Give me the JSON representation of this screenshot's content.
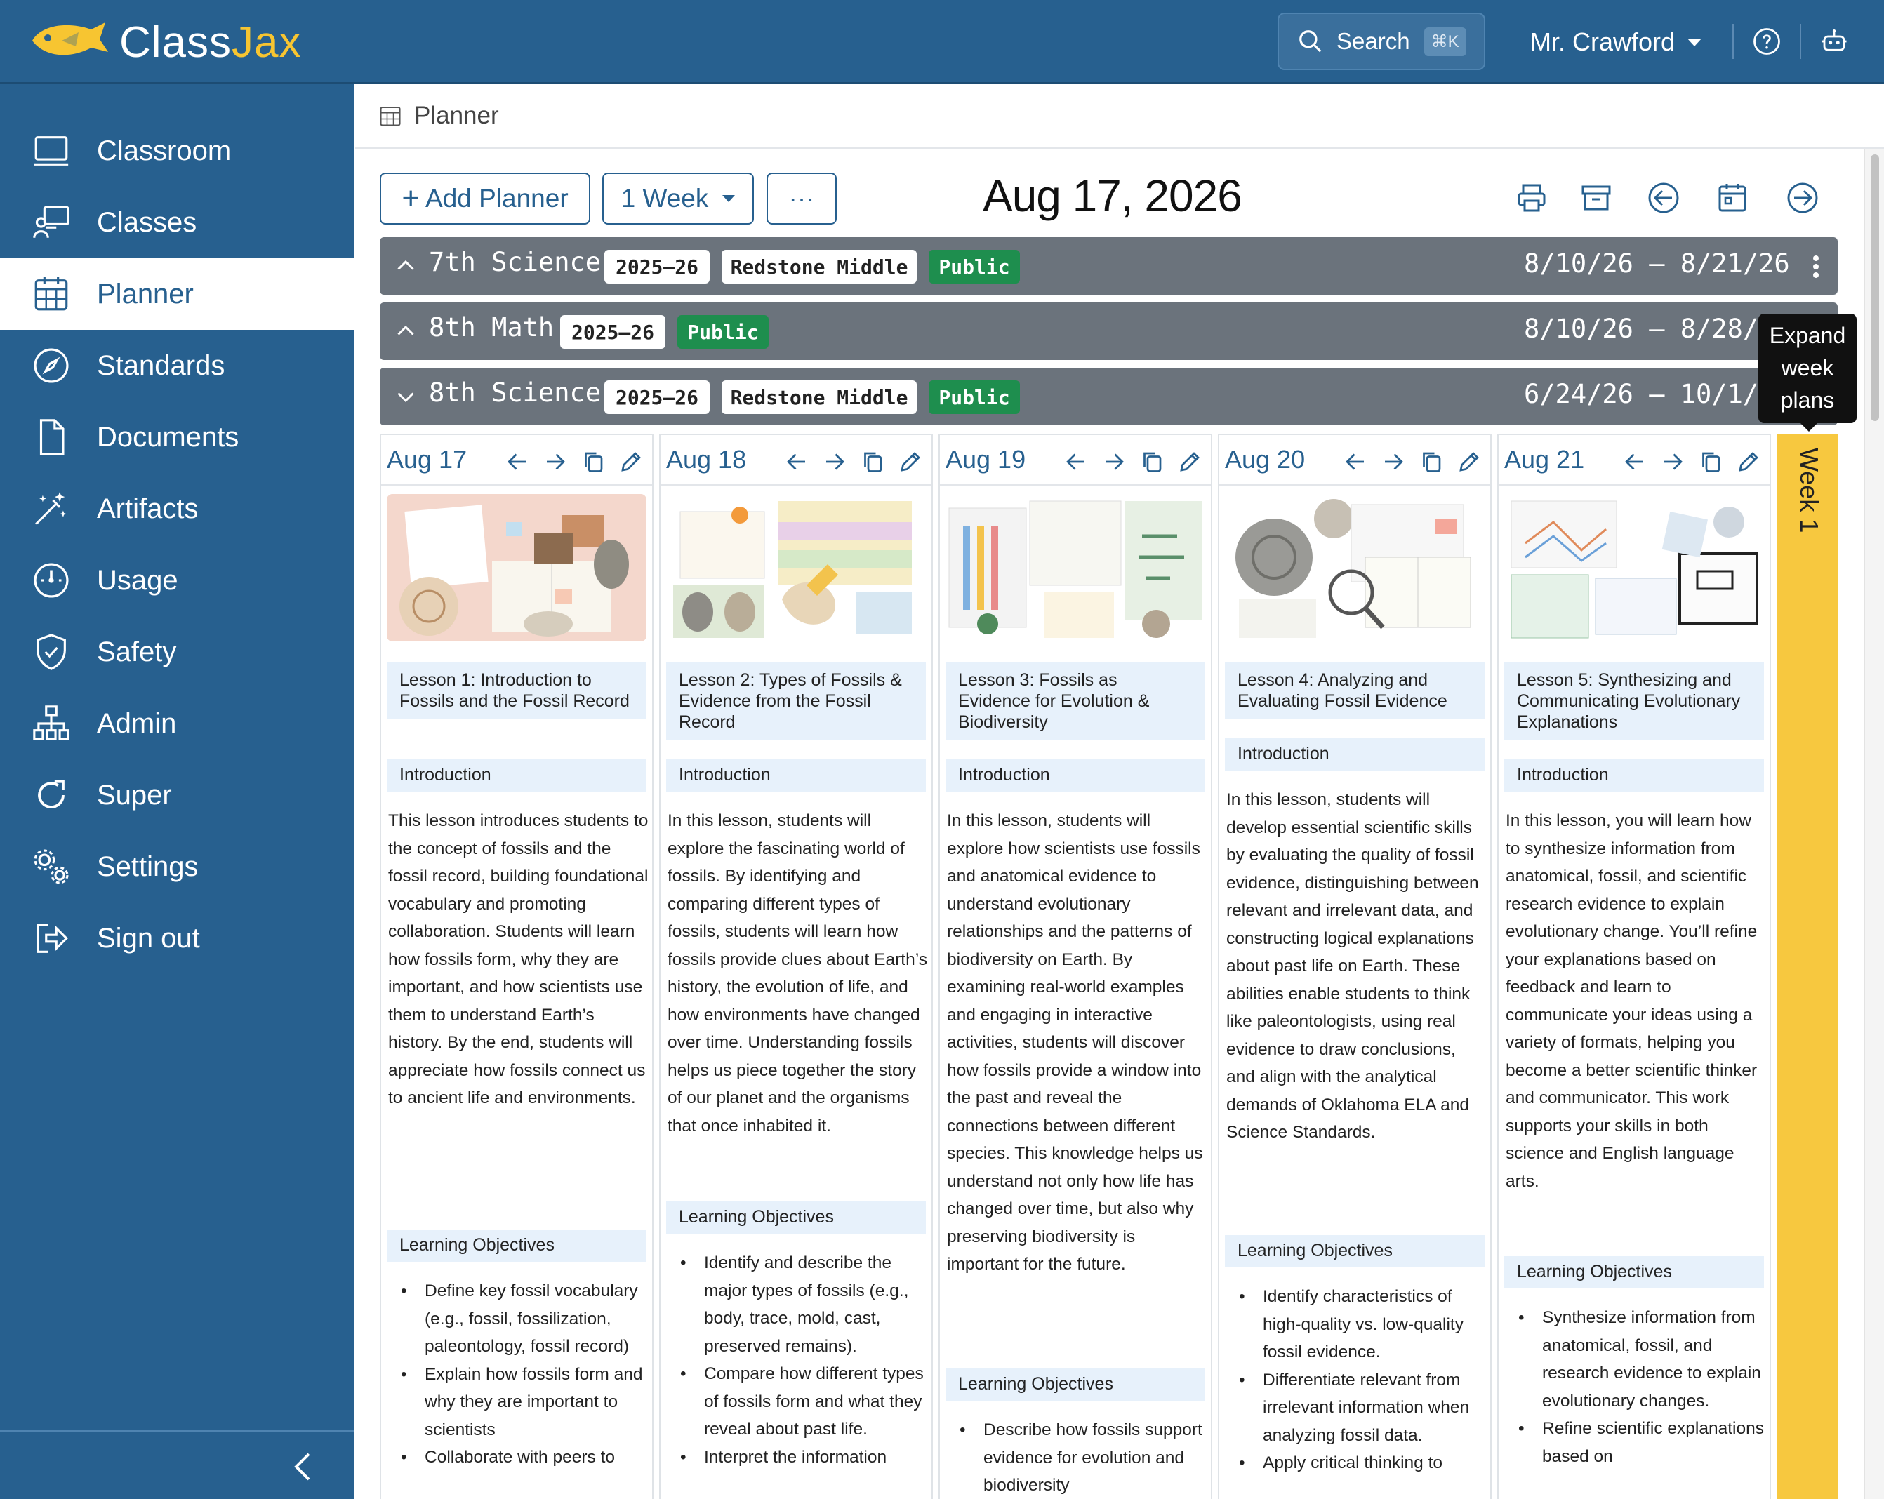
{
  "app": {
    "brand_part1": "Class",
    "brand_part2": "Jax",
    "search_label": "Search",
    "search_shortcut": "⌘K",
    "user_name": "Mr. Crawford"
  },
  "sidebar": {
    "items": [
      {
        "label": "Classroom",
        "icon": "monitor-icon"
      },
      {
        "label": "Classes",
        "icon": "teacher-board-icon"
      },
      {
        "label": "Planner",
        "icon": "calendar-grid-icon",
        "active": true
      },
      {
        "label": "Standards",
        "icon": "compass-icon"
      },
      {
        "label": "Documents",
        "icon": "document-icon"
      },
      {
        "label": "Artifacts",
        "icon": "magic-wand-icon"
      },
      {
        "label": "Usage",
        "icon": "gauge-icon"
      },
      {
        "label": "Safety",
        "icon": "shield-check-icon"
      },
      {
        "label": "Admin",
        "icon": "org-chart-icon"
      },
      {
        "label": "Super",
        "icon": "refresh-icon"
      },
      {
        "label": "Settings",
        "icon": "gears-icon"
      },
      {
        "label": "Sign out",
        "icon": "sign-out-icon"
      }
    ]
  },
  "breadcrumb": {
    "label": "Planner"
  },
  "toolbar": {
    "add_planner": "Add Planner",
    "range_select": "1 Week",
    "more": "···",
    "current_date": "Aug 17, 2026"
  },
  "planners": [
    {
      "name": "7th Science",
      "year": "2025–26",
      "school": "Redstone Middle",
      "visibility": "Public",
      "range": "8/10/26 – 8/21/26",
      "expanded": false
    },
    {
      "name": "8th Math",
      "year": "2025–26",
      "visibility": "Public",
      "range": "8/10/26 – 8/28/26",
      "expanded": false
    },
    {
      "name": "8th Science",
      "year": "2025–26",
      "school": "Redstone Middle",
      "visibility": "Public",
      "range": "6/24/26 – 10/1/26",
      "expanded": true
    }
  ],
  "days": [
    {
      "date": "Aug 17",
      "title": "Lesson 1: Introduction to Fossils and the Fossil Record",
      "intro_heading": "Introduction",
      "intro": "This lesson introduces students to the concept of fossils and the fossil record, building foundational vocabulary and promoting collaboration. Students will learn how fossils form, why they are important, and how scientists use them to understand Earth’s history. By the end, students will appreciate how fossils connect us to ancient life and environments.",
      "objectives_heading": "Learning Objectives",
      "objectives": [
        "Define key fossil vocabulary (e.g., fossil, fossilization, paleontology, fossil record)",
        "Explain how fossils form and why they are important to scientists",
        "Collaborate with peers to"
      ]
    },
    {
      "date": "Aug 18",
      "title": "Lesson 2: Types of Fossils & Evidence from the Fossil Record",
      "intro_heading": "Introduction",
      "intro": "In this lesson, students will explore the fascinating world of fossils. By identifying and comparing different types of fossils, students will learn how fossils provide clues about Earth’s history, the evolution of life, and how environments have changed over time. Understanding fossils helps us piece together the story of our planet and the organisms that once inhabited it.",
      "objectives_heading": "Learning Objectives",
      "objectives": [
        "Identify and describe the major types of fossils (e.g., body, trace, mold, cast, preserved remains).",
        "Compare how different types of fossils form and what they reveal about past life.",
        "Interpret the information"
      ]
    },
    {
      "date": "Aug 19",
      "title": "Lesson 3: Fossils as Evidence for Evolution & Biodiversity",
      "intro_heading": "Introduction",
      "intro": "In this lesson, students will explore how scientists use fossils and anatomical evidence to understand evolutionary relationships and the patterns of biodiversity on Earth. By examining real-world examples and engaging in interactive activities, students will discover how fossils provide a window into the past and reveal the connections between different species. This knowledge helps us understand not only how life has changed over time, but also why preserving biodiversity is important for the future.",
      "objectives_heading": "Learning Objectives",
      "objectives": [
        "Describe how fossils support evidence for evolution and biodiversity"
      ]
    },
    {
      "date": "Aug 20",
      "title": "Lesson 4: Analyzing and Evaluating Fossil Evidence",
      "intro_heading": "Introduction",
      "intro": "In this lesson, students will develop essential scientific skills by evaluating the quality of fossil evidence, distinguishing between relevant and irrelevant data, and constructing logical explanations about past life on Earth. These abilities enable students to think like paleontologists, using real evidence to draw conclusions, and align with the analytical demands of Oklahoma ELA and Science Standards.",
      "objectives_heading": "Learning Objectives",
      "objectives": [
        "Identify characteristics of high-quality vs. low-quality fossil evidence.",
        "Differentiate relevant from irrelevant information when analyzing fossil data.",
        "Apply critical thinking to"
      ]
    },
    {
      "date": "Aug 21",
      "title": "Lesson 5: Synthesizing and Communicating Evolutionary Explanations",
      "intro_heading": "Introduction",
      "intro": "In this lesson, you will learn how to synthesize information from anatomical, fossil, and scientific research evidence to explain evolutionary change. You’ll refine your explanations based on feedback and learn to communicate your ideas using a variety of formats, helping you become a better scientific thinker and communicator. This work supports your skills in both science and English language arts.",
      "objectives_heading": "Learning Objectives",
      "objectives": [
        "Synthesize information from anatomical, fossil, and research evidence to explain evolutionary changes.",
        "Refine scientific explanations based on"
      ]
    }
  ],
  "week_strip": {
    "label": "Week 1",
    "color": "#f7c83f"
  },
  "tooltip": {
    "text": "Expand week plans"
  },
  "colors": {
    "brand": "#27608f",
    "accent": "#f7c531",
    "planner_bar": "#6b737c",
    "public_badge": "#1e8e4e"
  }
}
